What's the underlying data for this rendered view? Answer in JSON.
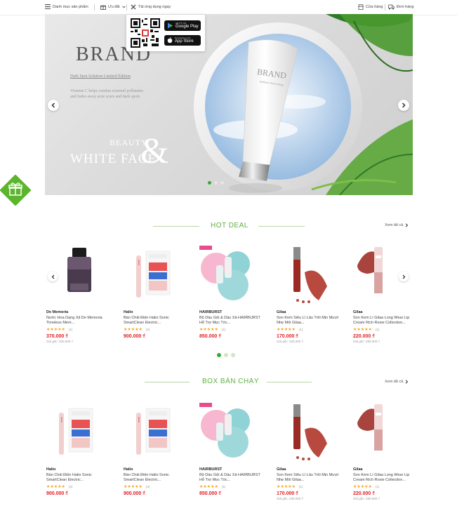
{
  "topbar": {
    "category_label": "Danh mục sản phẩm",
    "deals_label": "Ưu đãi",
    "download_label": "Tải ứng dụng ngay",
    "store_label": "Cửa hàng",
    "orders_label": "Đơn hàng"
  },
  "app_popup": {
    "google_small": "GET IT ON",
    "google_big": "Google Play",
    "apple_small": "Download on the",
    "apple_big": "App Store"
  },
  "banner": {
    "brand": "BRAND",
    "subtitle": "Dark Spot Solution Limited Edition",
    "description": "Vitamin C helps combat external pollutants and fades away acne scars and dark spots",
    "beauty": "BEAUTY",
    "white_face": "WHITE FACE",
    "amp": "&",
    "tube_brand": "BRAND",
    "tube_sub": "Brilliant Technology"
  },
  "hot_deal": {
    "title": "HOT DEAL",
    "see_all": "Xem tất cả",
    "products": [
      {
        "brand": "De Memoria",
        "name": "Nước Hoa Dạng Xịt De Memoria Timeless Mem...",
        "stars": "★★★★★",
        "count": "(1)",
        "price": "370.000 ₫",
        "old": "Giá gốc: 530.000 ₫"
      },
      {
        "brand": "Halio",
        "name": "Bàn Chải Điện Halio Sonic SmartClean Electric...",
        "stars": "★★★★★",
        "count": "(2)",
        "price": "900.000 ₫",
        "old": ""
      },
      {
        "brand": "HAIRBURST",
        "name": "Bộ Dầu Gội & Dầu Xả HAIRBURST Hỗ Trợ Mọc Tóc...",
        "stars": "★★★★★",
        "count": "(1)",
        "price": "850.000 ₫",
        "old": ""
      },
      {
        "brand": "Gilaa",
        "name": "Son Kem Siêu Lì Lâu Trôi Mịn Mượt Nhẹ Môi Gilaa...",
        "stars": "★★★★★",
        "count": "(1)",
        "price": "170.000 ₫",
        "old": "Giá gốc: 230.000 ₫"
      },
      {
        "brand": "Gilaa",
        "name": "Son Kem Lì Gilaa Long Wear Lip Cream Rich Rosie Collection...",
        "stars": "★★★★★",
        "count": "(1)",
        "price": "220.000 ₫",
        "old": "Giá gốc: 290.000 ₫"
      }
    ]
  },
  "best_seller": {
    "title": "BOX BÁN CHẠY",
    "see_all": "Xem tất cả",
    "products": [
      {
        "brand": "Halio",
        "name": "Bàn Chải Điện Halio Sonic SmartClean Electric...",
        "stars": "★★★★★",
        "count": "(2)",
        "price": "900.000 ₫",
        "old": ""
      },
      {
        "brand": "Halio",
        "name": "Bàn Chải Điện Halio Sonic SmartClean Electric...",
        "stars": "★★★★★",
        "count": "(2)",
        "price": "900.000 ₫",
        "old": ""
      },
      {
        "brand": "HAIRBURST",
        "name": "Bộ Dầu Gội & Dầu Xả HAIRBURST Hỗ Trợ Mọc Tóc...",
        "stars": "★★★★★",
        "count": "(1)",
        "price": "850.000 ₫",
        "old": ""
      },
      {
        "brand": "Gilaa",
        "name": "Son Kem Siêu Lì Lâu Trôi Mịn Mượt Nhẹ Môi Gilaa...",
        "stars": "★★★★★",
        "count": "(1)",
        "price": "170.000 ₫",
        "old": "Giá gốc: 230.000 ₫"
      },
      {
        "brand": "Gilaa",
        "name": "Son Kem Lì Gilaa Long Wear Lip Cream Rich Rosie Collection...",
        "stars": "★★★★★",
        "count": "(1)",
        "price": "220.000 ₫",
        "old": "Giá gốc: 290.000 ₫"
      }
    ]
  },
  "colors": {
    "accent_green": "#3aa935",
    "price_red": "#e31b23",
    "star": "#f5a623"
  }
}
